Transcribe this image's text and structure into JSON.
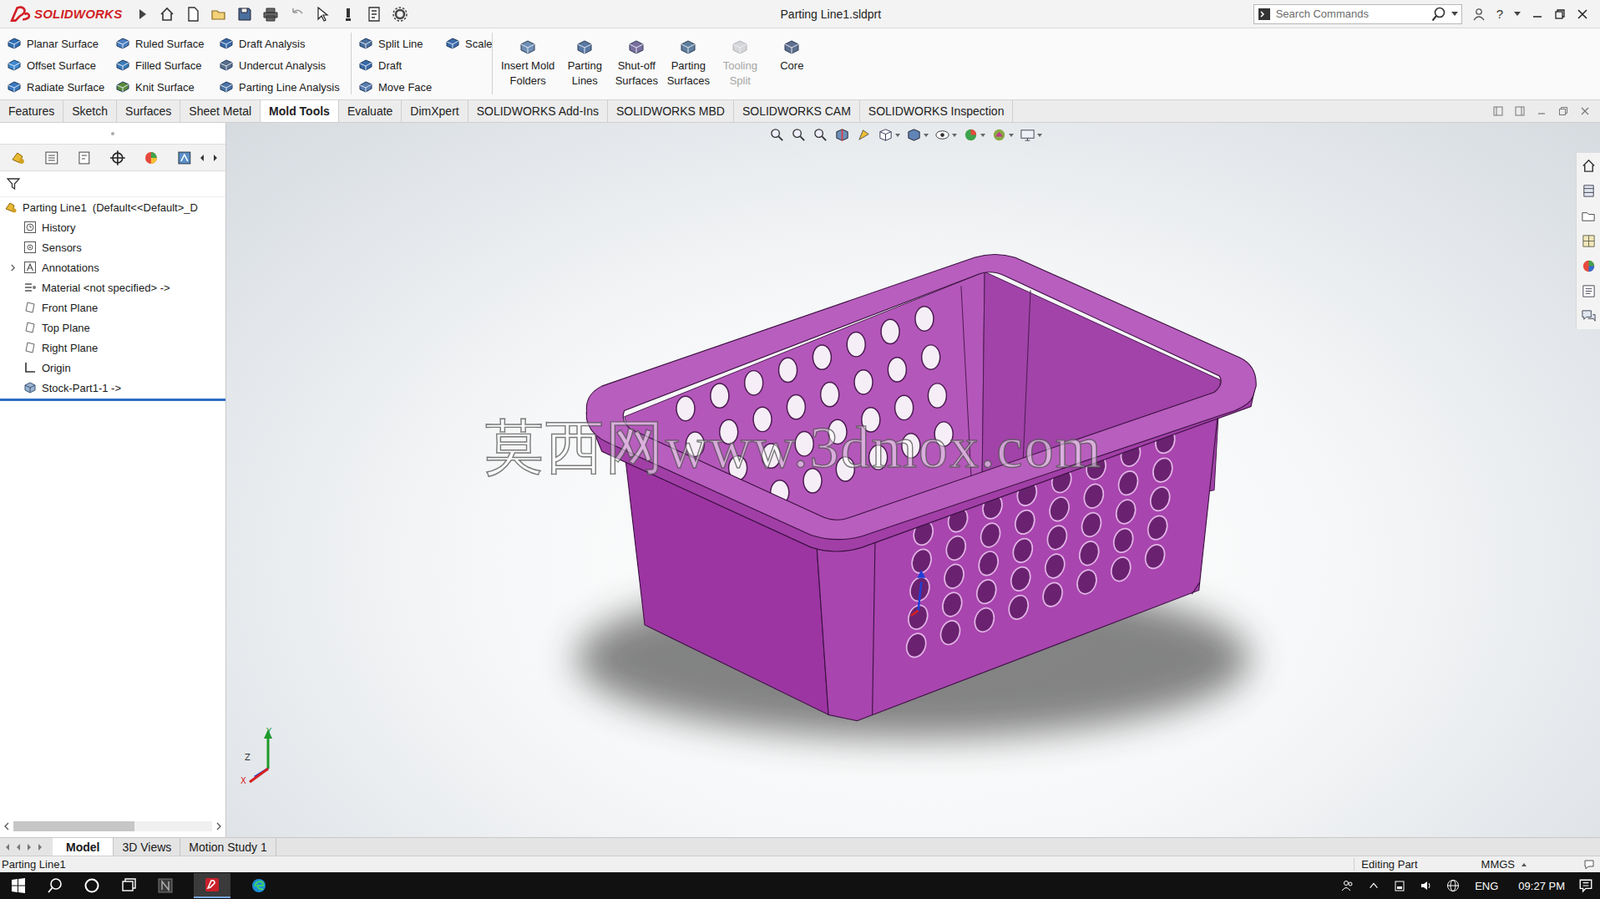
{
  "window": {
    "app": "SOLIDWORKS",
    "title": "Parting Line1.sldprt",
    "help": "?"
  },
  "search": {
    "placeholder": "Search Commands"
  },
  "ribbon": {
    "columns": [
      [
        "Planar Surface",
        "Offset Surface",
        "Radiate Surface"
      ],
      [
        "Ruled Surface",
        "Filled Surface",
        "Knit Surface"
      ],
      [
        "Draft Analysis",
        "Undercut Analysis",
        "Parting Line Analysis"
      ],
      [
        "Split Line",
        "Draft",
        "Move Face"
      ],
      [
        "Scale"
      ]
    ],
    "large_buttons": [
      {
        "lines": [
          "Insert Mold",
          "Folders"
        ],
        "disabled": false
      },
      {
        "lines": [
          "Parting",
          "Lines"
        ],
        "disabled": false
      },
      {
        "lines": [
          "Shut-off",
          "Surfaces"
        ],
        "disabled": false
      },
      {
        "lines": [
          "Parting",
          "Surfaces"
        ],
        "disabled": false
      },
      {
        "lines": [
          "Tooling",
          "Split"
        ],
        "disabled": true
      },
      {
        "lines": [
          "Core"
        ],
        "disabled": false
      }
    ]
  },
  "tabs": [
    {
      "label": "Features",
      "selected": false
    },
    {
      "label": "Sketch",
      "selected": false
    },
    {
      "label": "Surfaces",
      "selected": false
    },
    {
      "label": "Sheet Metal",
      "selected": false
    },
    {
      "label": "Mold Tools",
      "selected": true
    },
    {
      "label": "Evaluate",
      "selected": false
    },
    {
      "label": "DimXpert",
      "selected": false
    },
    {
      "label": "SOLIDWORKS Add-Ins",
      "selected": false
    },
    {
      "label": "SOLIDWORKS MBD",
      "selected": false
    },
    {
      "label": "SOLIDWORKS CAM",
      "selected": false
    },
    {
      "label": "SOLIDWORKS Inspection",
      "selected": false
    }
  ],
  "feature_tree": {
    "root": "Parting Line1  (Default<<Default>_D",
    "items": [
      {
        "label": "History",
        "has_children": false
      },
      {
        "label": "Sensors",
        "has_children": false
      },
      {
        "label": "Annotations",
        "has_children": true
      },
      {
        "label": "Material <not specified> ->",
        "has_children": false
      },
      {
        "label": "Front Plane",
        "has_children": false
      },
      {
        "label": "Top Plane",
        "has_children": false
      },
      {
        "label": "Right Plane",
        "has_children": false
      },
      {
        "label": "Origin",
        "has_children": false
      },
      {
        "label": "Stock-Part1-1 ->",
        "has_children": false
      }
    ]
  },
  "viewport": {
    "watermark": "莫西网www.3dmox.com",
    "triad": {
      "x": "X",
      "y": "Y",
      "z": "Z"
    }
  },
  "bottom_tabs": [
    {
      "label": "Model",
      "selected": true
    },
    {
      "label": "3D Views",
      "selected": false
    },
    {
      "label": "Motion Study 1",
      "selected": false
    }
  ],
  "status_bar": {
    "name": "Parting Line1",
    "mode": "Editing Part",
    "units": "MMGS"
  },
  "taskbar": {
    "language": "ENG",
    "time": "09:27 PM"
  }
}
